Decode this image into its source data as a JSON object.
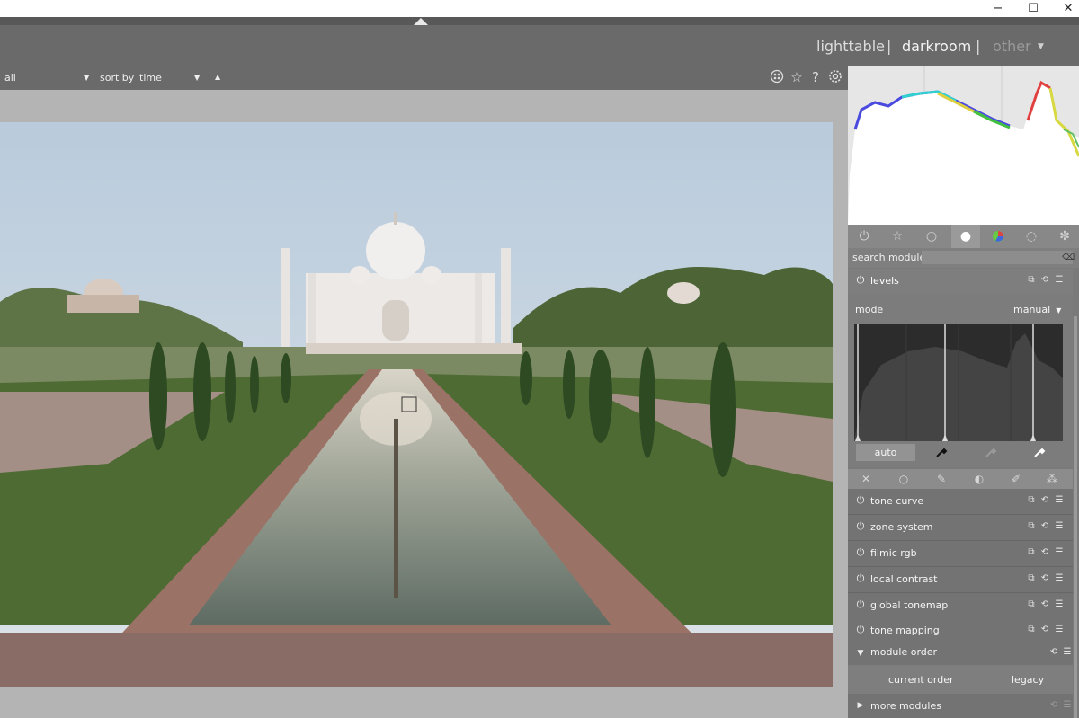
{
  "window": {
    "minimize": "−",
    "maximize": "☐",
    "close": "✕"
  },
  "views": {
    "lighttable": "lighttable",
    "darkroom": "darkroom",
    "other": "other",
    "sep": "|"
  },
  "filterbar": {
    "filter_value": "all",
    "sort_label": "sort by",
    "sort_value": "time"
  },
  "toolbar_icons": [
    "styles-icon",
    "star-icon",
    "help-icon",
    "gear-icon"
  ],
  "search": {
    "label": "search module",
    "placeholder": ""
  },
  "levels": {
    "title": "levels",
    "mode_label": "mode",
    "mode_value": "manual",
    "auto_label": "auto"
  },
  "modules": [
    {
      "title": "tone curve"
    },
    {
      "title": "zone system"
    },
    {
      "title": "filmic rgb"
    },
    {
      "title": "local contrast"
    },
    {
      "title": "global tonemap"
    },
    {
      "title": "tone mapping"
    }
  ],
  "module_order": {
    "title": "module order",
    "current": "current order",
    "legacy": "legacy"
  },
  "more_modules": {
    "title": "more modules"
  },
  "colors": {
    "panel": "#7a7a7a",
    "center_bg": "#b4b4b4",
    "header": "#6a6a6a"
  }
}
